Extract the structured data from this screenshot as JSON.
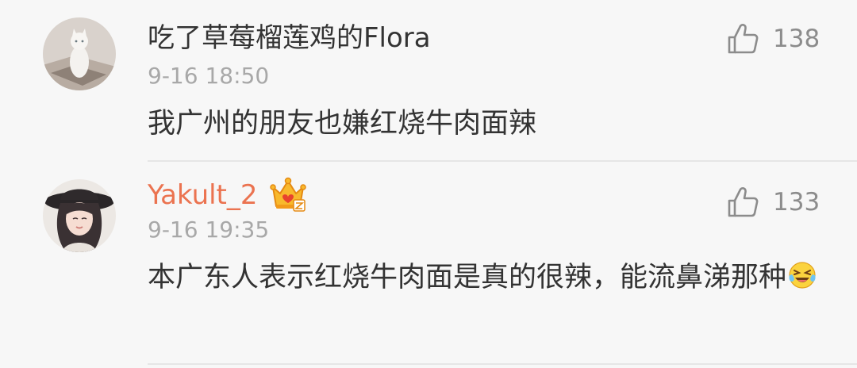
{
  "comments": [
    {
      "username": "吃了草莓榴莲鸡的Flora",
      "time": "9-16 18:50",
      "text": "我广州的朋友也嫌红烧牛肉面辣",
      "likes": "138",
      "avatar_icon": "white-cat-photo"
    },
    {
      "username": "Yakult_2",
      "time": "9-16 19:35",
      "text": "本广东人表示红烧牛肉面是真的很辣，能流鼻涕那种",
      "likes": "133",
      "avatar_icon": "girl-with-hat-photo",
      "badge_icon": "crown-vip-icon",
      "emoji_icon": "laughing-crying-emoji"
    }
  ],
  "colors": {
    "background": "#f7f7f7",
    "username_default": "#333333",
    "username_vip": "#eb7350",
    "timestamp": "#a8a8a8",
    "like_icon": "#8c8c8c"
  }
}
